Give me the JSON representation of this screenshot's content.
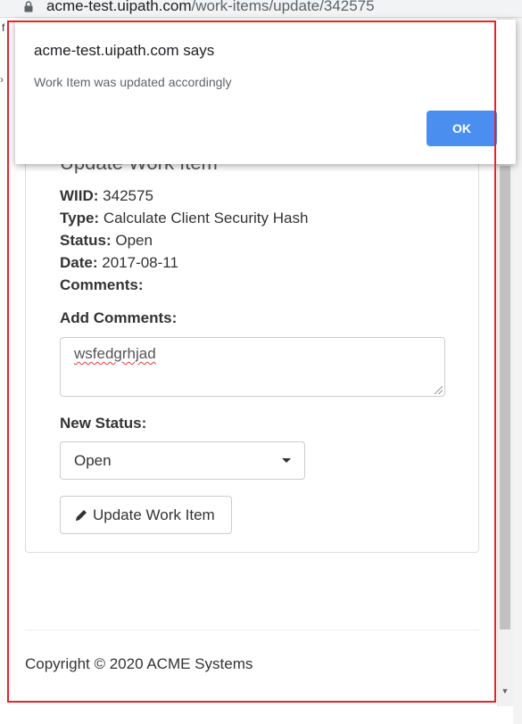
{
  "browser": {
    "url_host": "acme-test.uipath.com",
    "url_path": "/work-items/update/342575",
    "left_edge_fragment": "f",
    "left_edge_chevron": "›"
  },
  "dialog": {
    "title": "acme-test.uipath.com says",
    "message": "Work Item was updated accordingly",
    "ok_label": "OK"
  },
  "page": {
    "title": "Update Work Item",
    "fields": [
      {
        "label": "WIID:",
        "value": "342575"
      },
      {
        "label": "Type:",
        "value": "Calculate Client Security Hash"
      },
      {
        "label": "Status:",
        "value": "Open"
      },
      {
        "label": "Date:",
        "value": "2017-08-11"
      },
      {
        "label": "Comments:",
        "value": ""
      }
    ],
    "add_comments_label": "Add Comments:",
    "add_comments_value": "wsfedgrhjad",
    "new_status_label": "New Status:",
    "new_status_value": "Open",
    "update_button_label": "Update Work Item",
    "footer": "Copyright © 2020 ACME Systems"
  },
  "colors": {
    "highlight_frame": "#e0262d",
    "ok_button": "#4a8ef0"
  }
}
